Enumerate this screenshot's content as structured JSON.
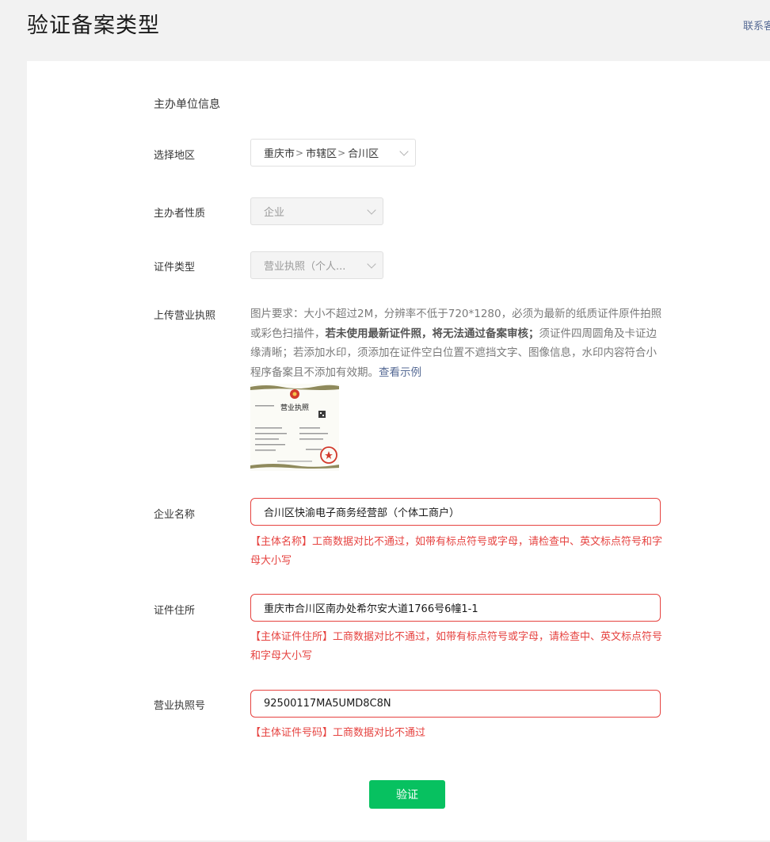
{
  "header": {
    "title": "验证备案类型",
    "contact_link": "联系客服"
  },
  "form": {
    "section_title": "主办单位信息",
    "region": {
      "label": "选择地区",
      "parts": [
        "重庆市",
        "市辖区",
        "合川区"
      ]
    },
    "organizer_type": {
      "label": "主办者性质",
      "value": "企业"
    },
    "cert_type": {
      "label": "证件类型",
      "value": "营业执照（个人..."
    },
    "upload": {
      "label": "上传营业执照",
      "desc_normal_1": "图片要求：大小不超过2M，分辨率不低于720*1280，必须为最新的纸质证件原件拍照或彩色扫描件，",
      "desc_bold": "若未使用最新证件照，将无法通过备案审核；",
      "desc_normal_2": "须证件四周圆角及卡证边缘清晰；若添加水印，须添加在证件空白位置不遮挡文字、图像信息，水印内容符合小程序备案且不添加有效期。",
      "example_link": "查看示例",
      "thumbnail_title": "营业执照"
    },
    "company_name": {
      "label": "企业名称",
      "value": "合川区快渝电子商务经营部（个体工商户）",
      "error": "【主体名称】工商数据对比不通过，如带有标点符号或字母，请检查中、英文标点符号和字母大小写"
    },
    "cert_address": {
      "label": "证件住所",
      "value": "重庆市合川区南办处希尔安大道1766号6幢1-1",
      "error": "【主体证件住所】工商数据对比不通过，如带有标点符号或字母，请检查中、英文标点符号和字母大小写"
    },
    "license_number": {
      "label": "营业执照号",
      "value": "92500117MA5UMD8C8N",
      "error": "【主体证件号码】工商数据对比不通过"
    },
    "verify_button": "验证"
  },
  "colors": {
    "error": "#e64340",
    "primary": "#07c160",
    "link": "#576b95",
    "page_background": "#f2f2f2"
  },
  "icons": {
    "select_arrow": "chevron-down-icon",
    "license_emblem": "national-emblem-icon",
    "license_seal": "red-seal-icon"
  }
}
